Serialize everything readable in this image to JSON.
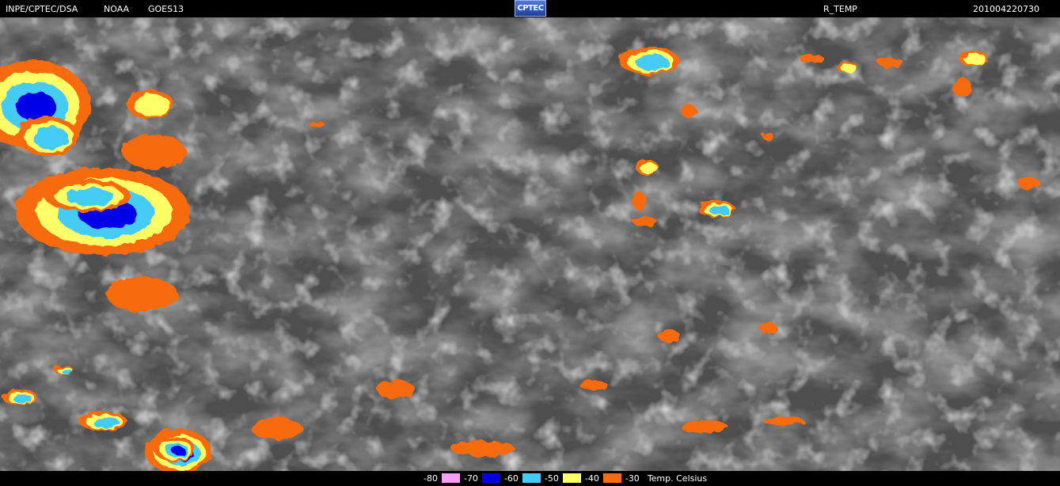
{
  "header": {
    "org": "INPE/CPTEC/DSA",
    "agency": "NOAA",
    "satellite": "GOES13",
    "logo": "CPTEC",
    "product": "R_TEMP",
    "timestamp": "201004220730"
  },
  "legend": {
    "items": [
      {
        "label": "-80",
        "color": "#000000"
      },
      {
        "label": "-70",
        "color": "#f79ef7"
      },
      {
        "label": "-60",
        "color": "#0000e6"
      },
      {
        "label": "-50",
        "color": "#44ccf6"
      },
      {
        "label": "-40",
        "color": "#ffff66"
      },
      {
        "label": "-30",
        "color": "#f76a10"
      }
    ],
    "unit": "Temp. Celsius"
  }
}
